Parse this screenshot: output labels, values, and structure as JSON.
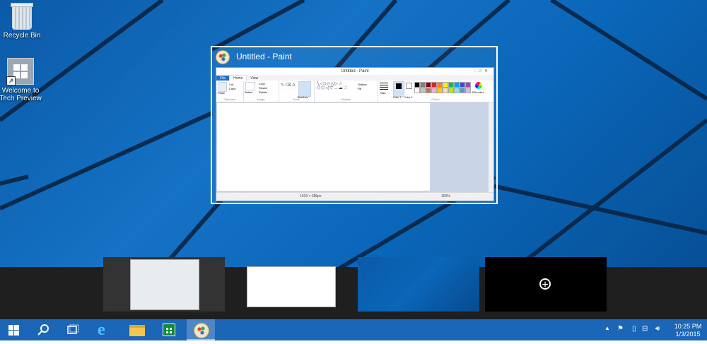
{
  "desktop": {
    "icons": [
      {
        "label": "Recycle Bin",
        "icon": "recycle-bin-icon"
      },
      {
        "label": "Welcome to Tech Preview",
        "label_line1": "Welcome to",
        "label_line2": "Tech Preview",
        "icon": "windows-logo-shortcut-icon"
      }
    ],
    "background_color": "#0a66b8"
  },
  "task_view": {
    "window_title": "Untitled - Paint",
    "window_icon": "paint-icon",
    "paint": {
      "titlebar": "Untitled - Paint",
      "tabs": [
        "File",
        "Home",
        "View"
      ],
      "groups": [
        "Clipboard",
        "Image",
        "Tools",
        "Shapes",
        "Colors"
      ],
      "buttons": {
        "paste": "Paste",
        "cut": "Cut",
        "copy": "Copy",
        "select": "Select",
        "crop": "Crop",
        "resize": "Resize",
        "rotate": "Rotate",
        "brushes": "Brushes",
        "outline": "Outline",
        "fill": "Fill",
        "size": "Size",
        "color1": "Color 1",
        "color2": "Color 2",
        "edit_colors": "Edit colors"
      },
      "status_size": "1019 × 386px",
      "zoom": "100%"
    },
    "palette": [
      "#000000",
      "#7f7f7f",
      "#880015",
      "#ed1c24",
      "#ff7f27",
      "#fff200",
      "#22b14c",
      "#00a2e8",
      "#3f48cc",
      "#a349a4",
      "#ffffff",
      "#c3c3c3",
      "#b97a57",
      "#ffaec9",
      "#ffc90e",
      "#efe4b0",
      "#b5e61d",
      "#99d9ea",
      "#7092be",
      "#c8bfe7"
    ]
  },
  "virtual_desktops": {
    "add_label": "+",
    "add_icon": "add-desktop-icon"
  },
  "taskbar": {
    "buttons": [
      {
        "name": "start-button",
        "icon": "windows-logo-icon"
      },
      {
        "name": "search-button",
        "icon": "search-icon"
      },
      {
        "name": "task-view-button",
        "icon": "task-view-icon"
      },
      {
        "name": "internet-explorer-button",
        "icon": "internet-explorer-icon"
      },
      {
        "name": "file-explorer-button",
        "icon": "folder-icon"
      },
      {
        "name": "store-button",
        "icon": "store-icon"
      },
      {
        "name": "paint-button",
        "icon": "paint-icon"
      }
    ],
    "tray": {
      "time": "10:25 PM",
      "date": "1/3/2015",
      "icons": [
        "show-hidden-icons-icon",
        "action-center-flag-icon",
        "power-icon",
        "network-icon",
        "volume-icon"
      ]
    },
    "color": "#1b66b6"
  }
}
